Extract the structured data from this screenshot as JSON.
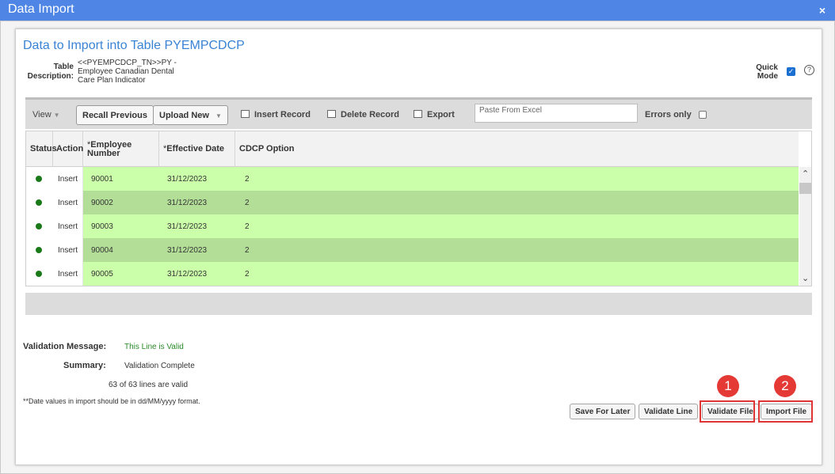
{
  "window": {
    "title": "Data Import",
    "close_glyph": "×"
  },
  "header": {
    "heading": "Data to Import into Table PYEMPCDCP",
    "table_description_label_1": "Table",
    "table_description_label_2": "Description:",
    "table_description_line1": "<<PYEMPCDCP_TN>>PY -",
    "table_description_line2": "Employee Canadian Dental",
    "table_description_line3": "Care Plan Indicator",
    "quick_mode_label_1": "Quick",
    "quick_mode_label_2": "Mode",
    "quick_mode_checked": true,
    "help_glyph": "?"
  },
  "toolbar": {
    "view_label": "View",
    "recall_previous": "Recall Previous",
    "upload_new": "Upload New",
    "insert_record": "Insert Record",
    "delete_record": "Delete Record",
    "export": "Export",
    "paste_placeholder": "Paste From Excel",
    "errors_only": "Errors only"
  },
  "grid": {
    "columns": {
      "status": "Status",
      "action": "Action",
      "employee_number_mark": "*",
      "employee_number_1": "Employee",
      "employee_number_2": "Number",
      "effective_date_mark": "*",
      "effective_date": "Effective Date",
      "cdcp_option": "CDCP Option"
    },
    "rows": [
      {
        "action": "Insert",
        "employee_number": "90001",
        "effective_date": "31/12/2023",
        "cdcp_option": "2"
      },
      {
        "action": "Insert",
        "employee_number": "90002",
        "effective_date": "31/12/2023",
        "cdcp_option": "2"
      },
      {
        "action": "Insert",
        "employee_number": "90003",
        "effective_date": "31/12/2023",
        "cdcp_option": "2"
      },
      {
        "action": "Insert",
        "employee_number": "90004",
        "effective_date": "31/12/2023",
        "cdcp_option": "2"
      },
      {
        "action": "Insert",
        "employee_number": "90005",
        "effective_date": "31/12/2023",
        "cdcp_option": "2"
      }
    ],
    "row_colors": [
      "#ccffaa",
      "#b3de98"
    ],
    "status_color": "#1a7a1a"
  },
  "validation": {
    "message_label": "Validation Message:",
    "message": "This Line is Valid",
    "summary_label": "Summary:",
    "summary": "Validation Complete",
    "lines_valid": "63 of 63 lines are valid",
    "date_note": "**Date values in import should be in dd/MM/yyyy format."
  },
  "actions": {
    "save_for_later": "Save For Later",
    "validate_line": "Validate Line",
    "validate_file": "Validate File",
    "import_file": "Import File",
    "badge_1": "1",
    "badge_2": "2"
  }
}
